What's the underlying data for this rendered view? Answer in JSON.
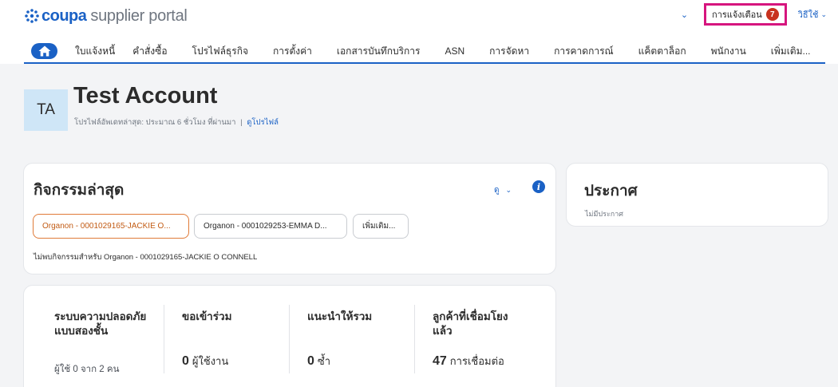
{
  "brand": {
    "name": "coupa",
    "product": "supplier portal"
  },
  "topbar": {
    "notifications_label": "การแจ้งเตือน",
    "notifications_count": "7",
    "help_label": "วิธีใช้"
  },
  "nav": {
    "items": [
      "ใบแจ้งหนี้",
      "คำสั่งซื้อ",
      "โปรไฟล์ธุรกิจ",
      "การตั้งค่า",
      "เอกสารบันทึกบริการ",
      "ASN",
      "การจัดหา",
      "การคาดการณ์",
      "แค็ตตาล็อก",
      "พนักงาน",
      "เพิ่มเติม..."
    ]
  },
  "account": {
    "initials": "TA",
    "name": "Test Account",
    "updated_text": "โปรไฟล์อัพเดทล่าสุด: ประมาณ 6 ชั่วโมง ที่ผ่านมา",
    "separator": "|",
    "view_profile_link": "ดูโปรไฟล์"
  },
  "activity": {
    "title": "กิจกรรมล่าสุด",
    "view_label": "ดู",
    "customers": [
      "Organon - 0001029165-JACKIE O...",
      "Organon - 0001029253-EMMA D...",
      "เพิ่มเติม..."
    ],
    "empty_message": "ไม่พบกิจกรรมสำหรับ Organon - 0001029165-JACKIE O CONNELL"
  },
  "announcements": {
    "title": "ประกาศ",
    "empty_message": "ไม่มีประกาศ"
  },
  "stats": [
    {
      "label": "ระบบความปลอดภัยแบบสองชั้น",
      "value": "",
      "unit": "",
      "sub": "ผู้ใช้ 0 จาก 2 คน"
    },
    {
      "label": "ขอเข้าร่วม",
      "value": "0",
      "unit": "ผู้ใช้งาน",
      "sub": ""
    },
    {
      "label": "แนะนำให้รวม",
      "value": "0",
      "unit": "ซ้ำ",
      "sub": ""
    },
    {
      "label": "ลูกค้าที่เชื่อมโยงแล้ว",
      "value": "47",
      "unit": "การเชื่อมต่อ",
      "sub": ""
    }
  ],
  "colors": {
    "brand_blue": "#1a61c5",
    "highlight": "#d6157e",
    "badge_red": "#c8321e",
    "active_pill": "#e07b39"
  }
}
